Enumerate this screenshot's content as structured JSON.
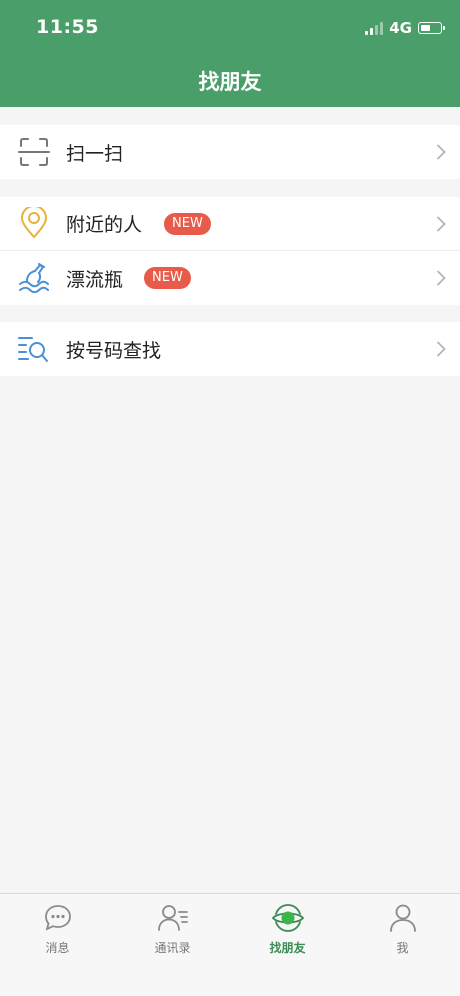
{
  "status_bar": {
    "time": "11:55",
    "network": "4G",
    "battery_level": 0.55
  },
  "header": {
    "title": "找朋友"
  },
  "menu": {
    "scan": {
      "label": "扫一扫",
      "icon": "scan-icon"
    },
    "nearby": {
      "label": "附近的人",
      "badge": "NEW",
      "icon": "location-pin-icon"
    },
    "bottle": {
      "label": "漂流瓶",
      "badge": "NEW",
      "icon": "drift-bottle-icon"
    },
    "search_number": {
      "label": "按号码查找",
      "icon": "search-list-icon"
    }
  },
  "tabbar": {
    "tabs": [
      {
        "label": "消息",
        "icon": "chat-bubble-icon"
      },
      {
        "label": "通讯录",
        "icon": "contacts-icon"
      },
      {
        "label": "找朋友",
        "icon": "find-friends-icon",
        "active": true
      },
      {
        "label": "我",
        "icon": "person-icon"
      }
    ]
  },
  "colors": {
    "header_bg": "#4a9e69",
    "badge": "#e85b4b",
    "active_tab": "#3c8a55"
  }
}
